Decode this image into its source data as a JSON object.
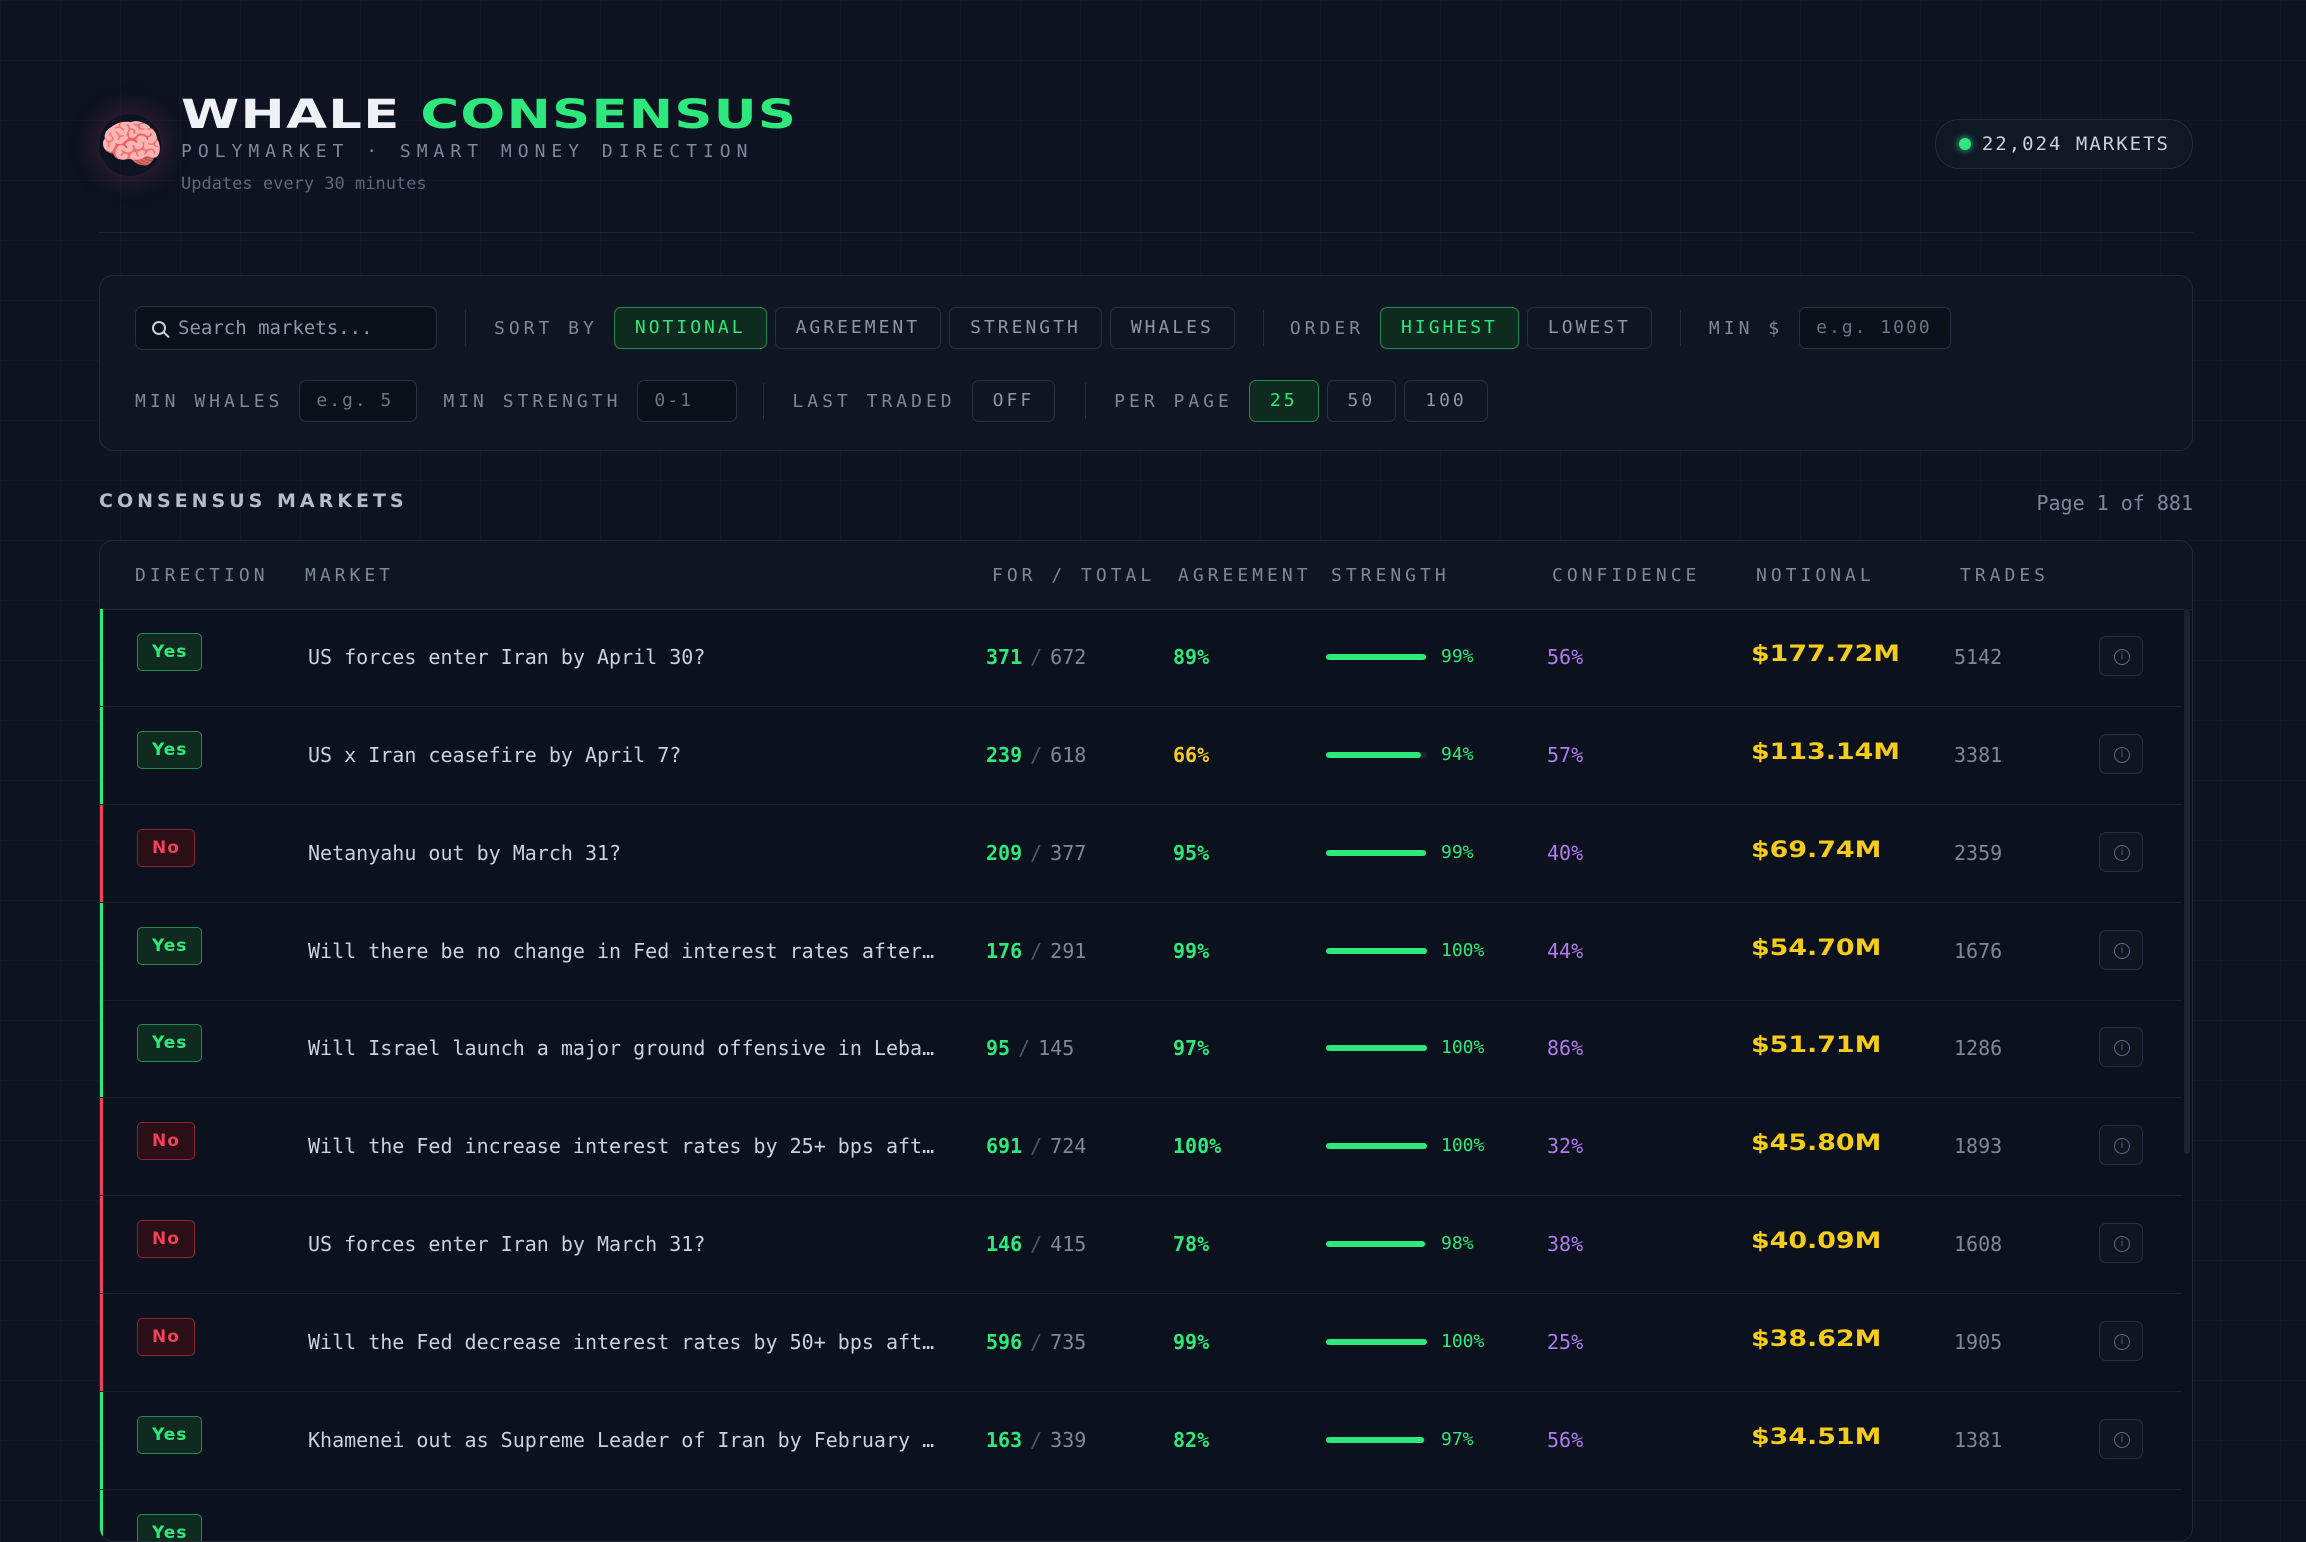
{
  "header": {
    "logo_icon": "brain-icon",
    "title_white": "WHALE",
    "title_green": "CONSENSUS",
    "subtitle": "POLYMARKET · SMART MONEY DIRECTION",
    "updates": "Updates every 30 minutes",
    "markets_count": "22,024 MARKETS"
  },
  "filters": {
    "search_placeholder": "Search markets...",
    "sort_label": "SORT BY",
    "sort_options": [
      "NOTIONAL",
      "AGREEMENT",
      "STRENGTH",
      "WHALES"
    ],
    "sort_selected": "NOTIONAL",
    "order_label": "ORDER",
    "order_options": [
      "HIGHEST",
      "LOWEST"
    ],
    "order_selected": "HIGHEST",
    "min_dollar_label": "MIN $",
    "min_dollar_placeholder": "e.g. 1000",
    "min_whales_label": "MIN WHALES",
    "min_whales_placeholder": "e.g. 5",
    "min_strength_label": "MIN STRENGTH",
    "min_strength_placeholder": "0-1",
    "last_traded_label": "LAST TRADED",
    "last_traded_value": "OFF",
    "per_page_label": "PER PAGE",
    "per_page_options": [
      "25",
      "50",
      "100"
    ],
    "per_page_selected": "25"
  },
  "section": {
    "title": "CONSENSUS MARKETS",
    "page_info": "Page 1 of 881"
  },
  "table": {
    "columns": [
      "DIRECTION",
      "MARKET",
      "FOR / TOTAL",
      "AGREEMENT",
      "STRENGTH",
      "CONFIDENCE",
      "NOTIONAL",
      "TRADES"
    ],
    "rows": [
      {
        "direction": "Yes",
        "market": "US forces enter Iran by April 30?",
        "for": "371",
        "total": "672",
        "agreement": "89%",
        "strength": "99%",
        "strength_value": 0.99,
        "confidence": "56%",
        "notional": "$177.72M",
        "trades": "5142"
      },
      {
        "direction": "Yes",
        "market": "US x Iran ceasefire by April 7?",
        "for": "239",
        "total": "618",
        "agreement": "66%",
        "strength": "94%",
        "strength_value": 0.94,
        "confidence": "57%",
        "notional": "$113.14M",
        "trades": "3381"
      },
      {
        "direction": "No",
        "market": "Netanyahu out by March 31?",
        "for": "209",
        "total": "377",
        "agreement": "95%",
        "strength": "99%",
        "strength_value": 0.99,
        "confidence": "40%",
        "notional": "$69.74M",
        "trades": "2359"
      },
      {
        "direction": "Yes",
        "market": "Will there be no change in Fed interest rates after…",
        "for": "176",
        "total": "291",
        "agreement": "99%",
        "strength": "100%",
        "strength_value": 1.0,
        "confidence": "44%",
        "notional": "$54.70M",
        "trades": "1676"
      },
      {
        "direction": "Yes",
        "market": "Will Israel launch a major ground offensive in Leba…",
        "for": "95",
        "total": "145",
        "agreement": "97%",
        "strength": "100%",
        "strength_value": 1.0,
        "confidence": "86%",
        "notional": "$51.71M",
        "trades": "1286"
      },
      {
        "direction": "No",
        "market": "Will the Fed increase interest rates by 25+ bps aft…",
        "for": "691",
        "total": "724",
        "agreement": "100%",
        "strength": "100%",
        "strength_value": 1.0,
        "confidence": "32%",
        "notional": "$45.80M",
        "trades": "1893"
      },
      {
        "direction": "No",
        "market": "US forces enter Iran by March 31?",
        "for": "146",
        "total": "415",
        "agreement": "78%",
        "strength": "98%",
        "strength_value": 0.98,
        "confidence": "38%",
        "notional": "$40.09M",
        "trades": "1608"
      },
      {
        "direction": "No",
        "market": "Will the Fed decrease interest rates by 50+ bps aft…",
        "for": "596",
        "total": "735",
        "agreement": "99%",
        "strength": "100%",
        "strength_value": 1.0,
        "confidence": "25%",
        "notional": "$38.62M",
        "trades": "1905"
      },
      {
        "direction": "Yes",
        "market": "Khamenei out as Supreme Leader of Iran by February …",
        "for": "163",
        "total": "339",
        "agreement": "82%",
        "strength": "97%",
        "strength_value": 0.97,
        "confidence": "56%",
        "notional": "$34.51M",
        "trades": "1381"
      },
      {
        "direction": "Yes",
        "market": "",
        "for": "",
        "total": "",
        "agreement": "",
        "strength": "",
        "strength_value": 0,
        "confidence": "",
        "notional": "",
        "trades": ""
      }
    ],
    "info_icon": "info-icon"
  },
  "colors": {
    "accent_green": "#2ee87e",
    "no_red": "#f0405a",
    "agreement_yellow": "#f5cc1a",
    "confidence_purple": "#b07aef",
    "notional_yellow": "#f5cc1a",
    "background": "#0d1320"
  }
}
